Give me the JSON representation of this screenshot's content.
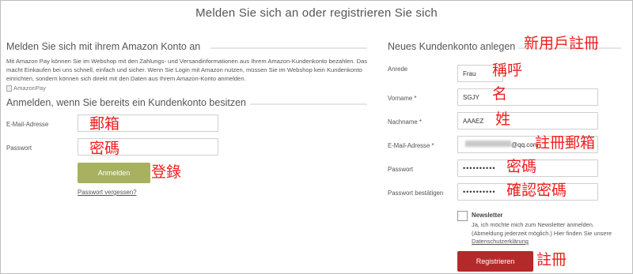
{
  "page": {
    "title": "Melden Sie sich an oder registrieren Sie sich"
  },
  "left": {
    "amazon_title": "Melden Sie sich mit ihrem Amazon Konto an",
    "amazon_intro": "Mit Amazon Pay können Sie im Webshop mit den Zahlungs- und Versandinformationen aus Ihrem Amazon-Kundenkonto bezahlen. Das macht Einkaufen bei uns schnell, einfach und sicher. Wenn Sie Login mit Amazon nutzen, müssen Sie im Webshop kein Kundenkonto einrichten, sondern können sich direkt mit den Daten aus Ihrem Amazon-Konto anmelden.",
    "amazonpay_alt": "AmazonPay",
    "login_title": "Anmelden, wenn Sie bereits ein Kundenkonto besitzen",
    "email_label": "E-Mail-Adresse",
    "email_value": "",
    "password_label": "Passwort",
    "password_value": "",
    "login_button": "Anmelden",
    "forgot_link": "Passwort vergessen?"
  },
  "right": {
    "title": "Neues Kundenkonto anlegen",
    "salutation_label": "Anrede",
    "salutation_value": "Frau",
    "firstname_label": "Vorname *",
    "firstname_value": "SGJY",
    "lastname_label": "Nachname *",
    "lastname_value": "AAAEZ",
    "email_label": "E-Mail-Adresse *",
    "email_value": "@qq.com",
    "password_label": "Passwort",
    "password_value": "••••••••••",
    "password_confirm_label": "Passwort bestätigen",
    "password_confirm_value": "••••••••••",
    "newsletter_title": "Newsletter",
    "newsletter_text": "Ja, ich möchte mich zum Newsletter anmelden. (Abmeldung jederzeit möglich.) Hier finden Sie unsere",
    "privacy_link": "Datenschutzerklärung",
    "register_button": "Registrieren"
  },
  "annotations": {
    "new_account": "新用戶註冊",
    "salutation": "稱呼",
    "firstname": "名",
    "lastname": "姓",
    "register_email": "註冊郵箱",
    "password": "密碼",
    "confirm_password": "確認密碼",
    "register": "註冊",
    "login_email": "郵箱",
    "login_password": "密碼",
    "login": "登錄"
  },
  "colors": {
    "login_button": "#a7b15f",
    "register_button": "#b42a2a",
    "annotation": "#ef1d1d"
  }
}
